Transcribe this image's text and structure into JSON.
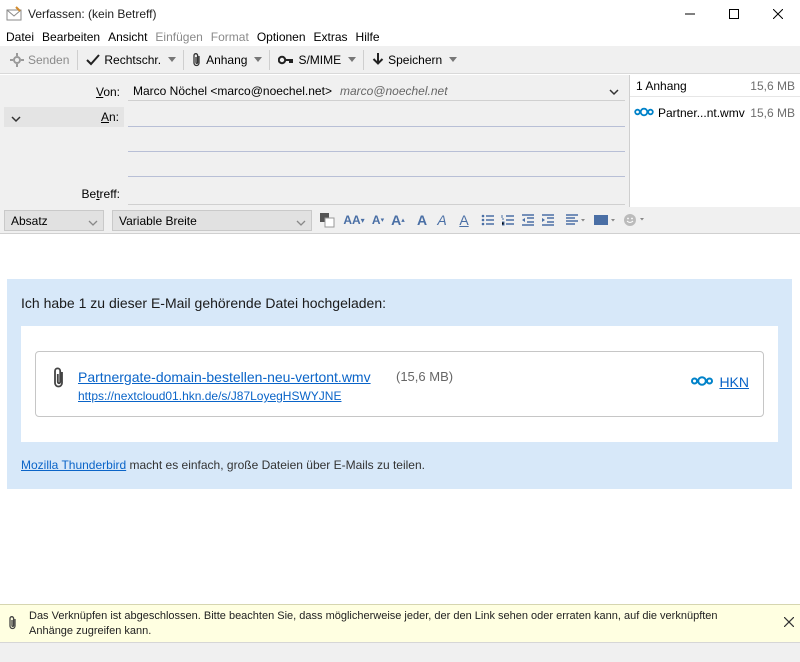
{
  "window": {
    "title": "Verfassen: (kein Betreff)",
    "app_icon": "compose-icon"
  },
  "menu": {
    "items": [
      {
        "label": "Datei",
        "disabled": false
      },
      {
        "label": "Bearbeiten",
        "disabled": false
      },
      {
        "label": "Ansicht",
        "disabled": false
      },
      {
        "label": "Einfügen",
        "disabled": true
      },
      {
        "label": "Format",
        "disabled": true
      },
      {
        "label": "Optionen",
        "disabled": false
      },
      {
        "label": "Extras",
        "disabled": false
      },
      {
        "label": "Hilfe",
        "disabled": false
      }
    ]
  },
  "toolbar": {
    "send_label": "Senden",
    "spelling_label": "Rechtschr.",
    "attach_label": "Anhang",
    "smime_label": "S/MIME",
    "save_label": "Speichern"
  },
  "header": {
    "from_label": "Von:",
    "from_value": "Marco Nöchel <marco@noechel.net>",
    "from_alt": "marco@noechel.net",
    "to_label": "An:",
    "to_value": "",
    "subject_label": "Betreff:",
    "subject_value": ""
  },
  "attachments": {
    "count_label": "1 Anhang",
    "total_size": "15,6 MB",
    "items": [
      {
        "name": "Partner...nt.wmv",
        "size": "15,6 MB"
      }
    ]
  },
  "format_bar": {
    "paragraph_value": "Absatz",
    "font_value": "Variable Breite"
  },
  "body": {
    "intro": "Ich habe 1 zu dieser E-Mail gehörende Datei hochgeladen:",
    "file_name": "Partnergate-domain-bestellen-neu-vertont.wmv",
    "file_size": "(15,6 MB)",
    "file_url": "https://nextcloud01.hkn.de/s/J87LoyegHSWYJNE",
    "provider_name": "HKN",
    "footer_link": "Mozilla Thunderbird",
    "footer_text": "macht es einfach, große Dateien über E-Mails zu teilen."
  },
  "notification": {
    "text": "Das Verknüpfen ist abgeschlossen. Bitte beachten Sie, dass möglicherweise jeder, der den Link sehen oder erraten kann, auf die verknüpften Anhänge zugreifen kann."
  },
  "colors": {
    "accent": "#0a64c8",
    "card_bg": "#d7e8f9",
    "notify_bg": "#ffffe1",
    "nextcloud": "#0082c9"
  }
}
